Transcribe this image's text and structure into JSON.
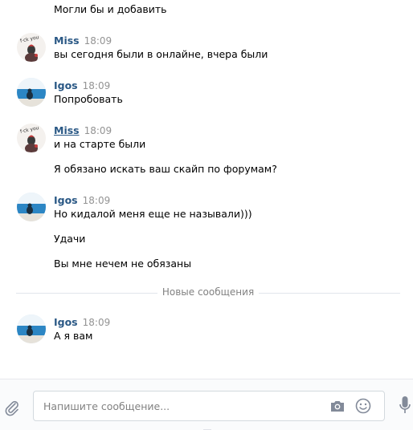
{
  "messages": {
    "m0_line1": "Могли бы и добавить",
    "g1": {
      "name": "Miss",
      "time": "18:09",
      "lines": [
        "вы сегодня были в онлайне, вчера были"
      ]
    },
    "g2": {
      "name": "Igos",
      "time": "18:09",
      "lines": [
        "Попробовать"
      ]
    },
    "g3": {
      "name": "Miss",
      "time": "18:09",
      "lines": [
        "и на старте были",
        "Я обязано искать ваш скайп по форумам?"
      ]
    },
    "g4": {
      "name": "Igos",
      "time": "18:09",
      "lines": [
        "Но кидалой меня еще не называли)))",
        "Удачи",
        "Вы мне нечем не обязаны"
      ]
    },
    "g5": {
      "name": "Igos",
      "time": "18:09",
      "lines": [
        "А я вам"
      ]
    }
  },
  "divider": {
    "label": "Новые сообщения"
  },
  "composer": {
    "placeholder": "Напишите сообщение..."
  },
  "icons": {
    "attach": "paperclip-icon",
    "camera": "camera-icon",
    "emoji": "smile-icon",
    "voice": "microphone-icon"
  },
  "colors": {
    "author": "#2a5885",
    "time": "#939393",
    "divider": "#e1e5eb",
    "icon": "#828a99"
  }
}
